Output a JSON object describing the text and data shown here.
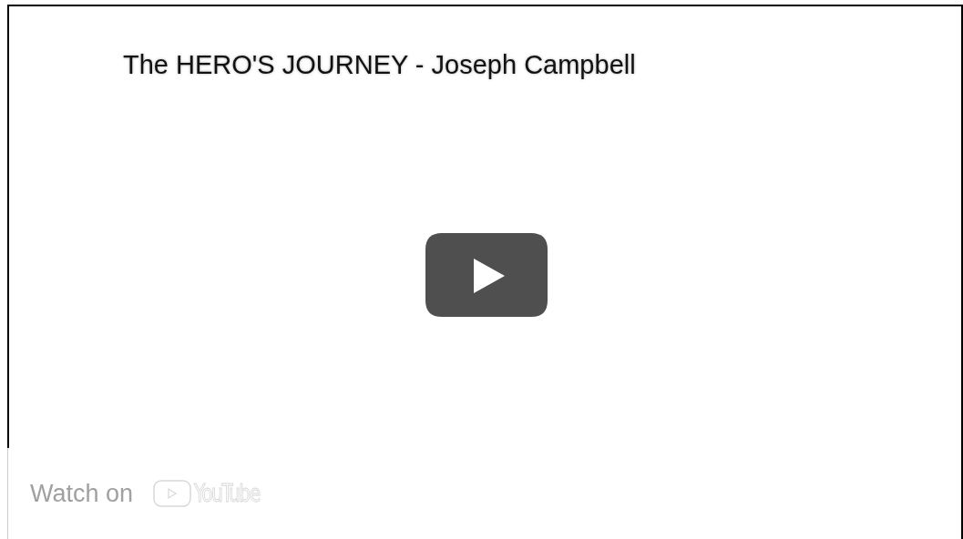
{
  "video": {
    "title": "The HERO'S JOURNEY - Joseph Campbell"
  },
  "watch_on": {
    "label": "Watch on",
    "logo_text": "YouTube"
  }
}
